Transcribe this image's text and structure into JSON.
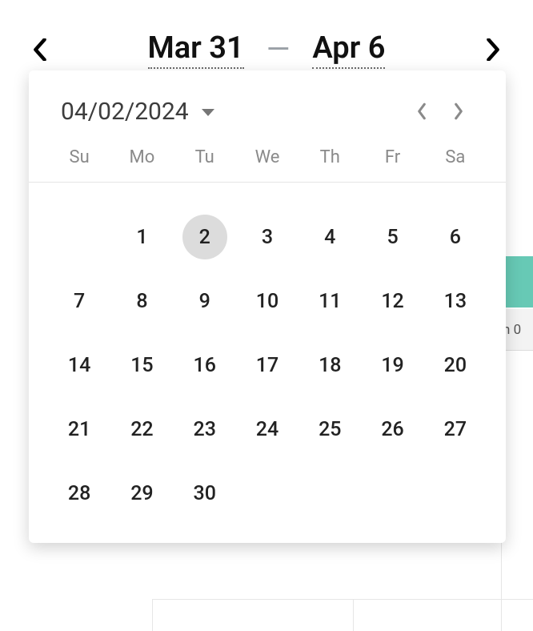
{
  "header": {
    "start_label": "Mar 31",
    "dash": "—",
    "end_label": "Apr 6"
  },
  "datepicker": {
    "selected_label": "04/02/2024",
    "weekdays": [
      "Su",
      "Mo",
      "Tu",
      "We",
      "Th",
      "Fr",
      "Sa"
    ],
    "selected_day": 2,
    "leading_blanks": 1,
    "days_in_month": 30
  },
  "background": {
    "label_fragment": "n 0"
  }
}
